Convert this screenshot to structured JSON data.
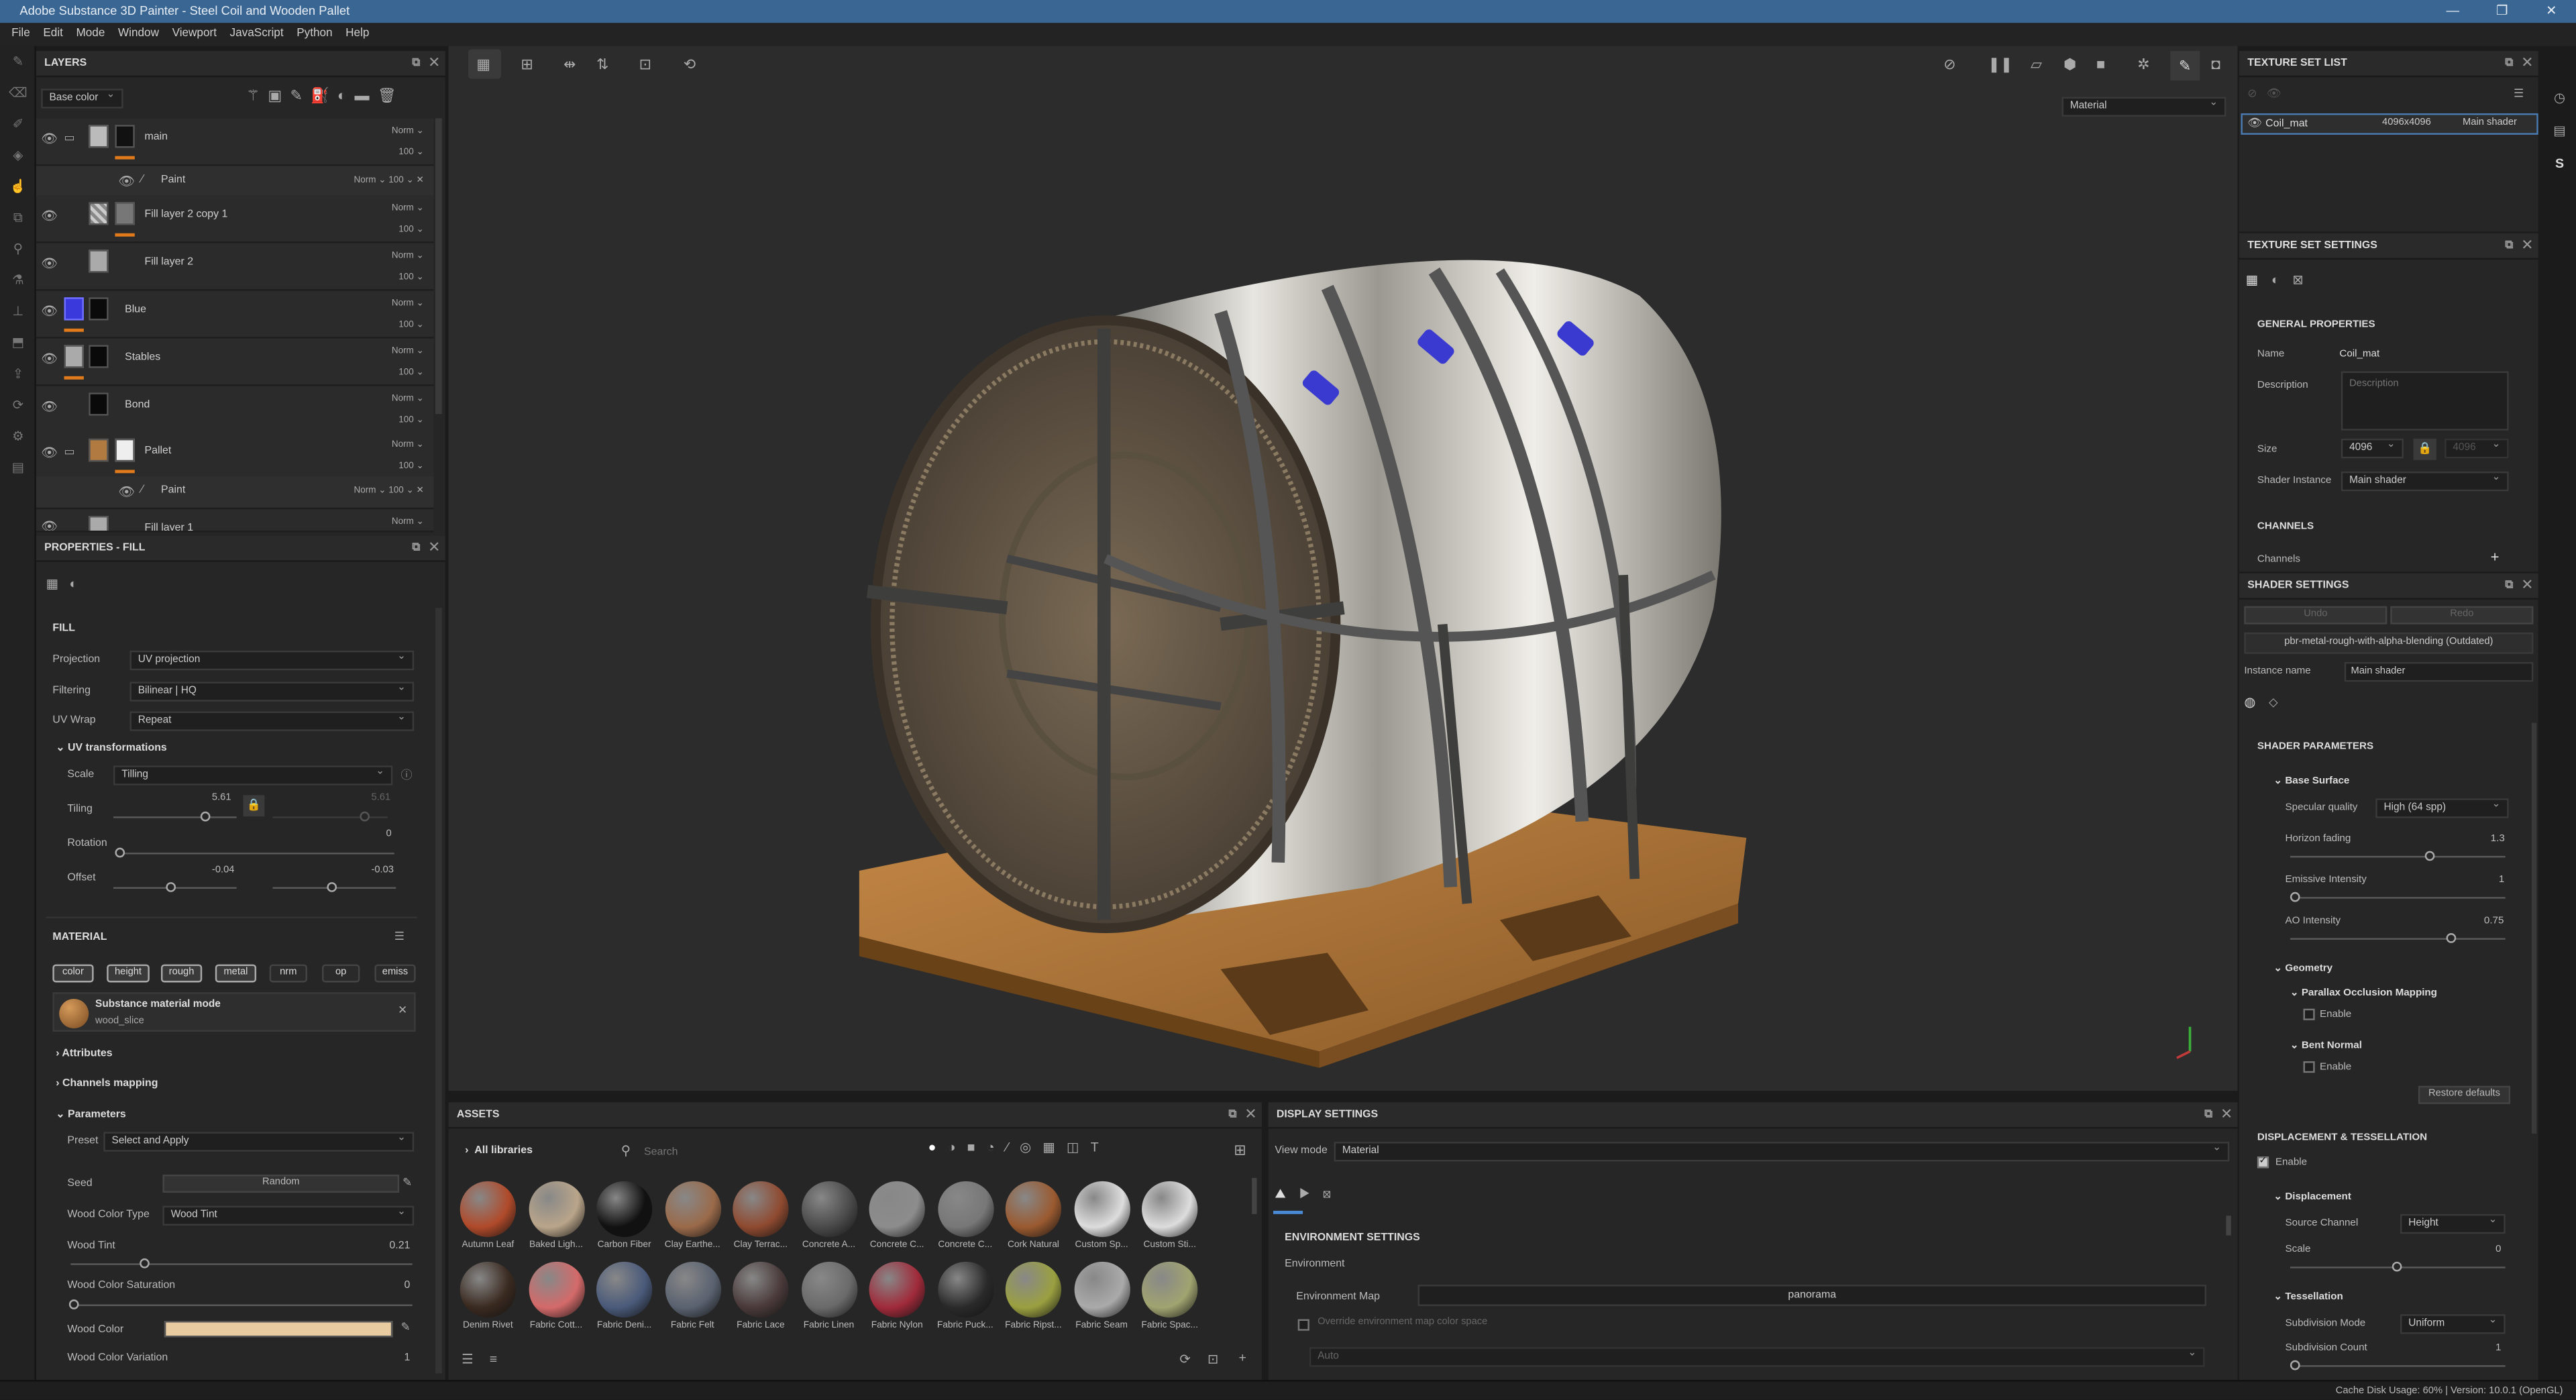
{
  "window": {
    "title": "Adobe Substance 3D Painter - Steel Coil and Wooden Pallet"
  },
  "menu": [
    "File",
    "Edit",
    "Mode",
    "Window",
    "Viewport",
    "JavaScript",
    "Python",
    "Help"
  ],
  "layers": {
    "title": "LAYERS",
    "channel": "Base color",
    "items": [
      {
        "name": "main",
        "blend": "Norm",
        "opacity": "100",
        "type": "folder"
      },
      {
        "name": "Paint",
        "blend": "Norm",
        "opacity": "100",
        "type": "sub"
      },
      {
        "name": "Fill layer 2 copy 1",
        "blend": "Norm",
        "opacity": "100"
      },
      {
        "name": "Fill layer 2",
        "blend": "Norm",
        "opacity": "100"
      },
      {
        "name": "Blue",
        "blend": "Norm",
        "opacity": "100"
      },
      {
        "name": "Stables",
        "blend": "Norm",
        "opacity": "100"
      },
      {
        "name": "Bond",
        "blend": "Norm",
        "opacity": "100"
      },
      {
        "name": "Pallet",
        "blend": "Norm",
        "opacity": "100",
        "type": "folder"
      },
      {
        "name": "Paint",
        "blend": "Norm",
        "opacity": "100",
        "type": "sub"
      },
      {
        "name": "Fill layer 1",
        "blend": "Norm",
        "opacity": ""
      }
    ]
  },
  "properties": {
    "title": "PROPERTIES - FILL",
    "section": "FILL",
    "projection_label": "Projection",
    "projection": "UV projection",
    "filtering_label": "Filtering",
    "filtering": "Bilinear | HQ",
    "uvwrap_label": "UV Wrap",
    "uvwrap": "Repeat",
    "uvtrans": "UV transformations",
    "scale_label": "Scale",
    "scale": "Tilling",
    "tiling_label": "Tiling",
    "tiling": "5.61",
    "tiling2": "5.61",
    "rotation_label": "Rotation",
    "rotation": "0",
    "offset_label": "Offset",
    "offset1": "-0.04",
    "offset2": "-0.03",
    "material": "MATERIAL",
    "chips": [
      "color",
      "height",
      "rough",
      "metal",
      "nrm",
      "op",
      "emiss"
    ],
    "mat_mode": "Substance material mode",
    "mat_name": "wood_slice",
    "attributes": "Attributes",
    "channels_mapping": "Channels mapping",
    "parameters": "Parameters",
    "preset_label": "Preset",
    "preset": "Select and Apply",
    "seed_label": "Seed",
    "seed": "Random",
    "wct_label": "Wood Color Type",
    "wct": "Wood Tint",
    "wtint_label": "Wood Tint",
    "wtint": "0.21",
    "wcs_label": "Wood Color Saturation",
    "wcs": "0",
    "wc_label": "Wood Color",
    "wood_color": "#e8cba0",
    "wcv_label": "Wood Color Variation",
    "wcv": "1"
  },
  "viewport": {
    "mode": "Material"
  },
  "assets": {
    "title": "ASSETS",
    "library": "All libraries",
    "search_placeholder": "Search",
    "row1": [
      {
        "n": "Autumn Leaf",
        "c": "#b04a2a"
      },
      {
        "n": "Baked Ligh...",
        "c": "#b9a58a"
      },
      {
        "n": "Carbon Fiber",
        "c": "#111"
      },
      {
        "n": "Clay Earthe...",
        "c": "#9a6a4a"
      },
      {
        "n": "Clay Terrac...",
        "c": "#8f4a30"
      },
      {
        "n": "Concrete A...",
        "c": "#4a4a4a"
      },
      {
        "n": "Concrete C...",
        "c": "#8c8c8c"
      },
      {
        "n": "Concrete C...",
        "c": "#777"
      },
      {
        "n": "Cork Natural",
        "c": "#9a5a30"
      },
      {
        "n": "Custom Sp...",
        "c": "#ddd"
      },
      {
        "n": "Custom Sti...",
        "c": "#ddd"
      }
    ],
    "row2": [
      {
        "n": "Denim Rivet",
        "c": "#3a2a20"
      },
      {
        "n": "Fabric Cott...",
        "c": "#d46a6a"
      },
      {
        "n": "Fabric Deni...",
        "c": "#4a5a7a"
      },
      {
        "n": "Fabric Felt",
        "c": "#5a6270"
      },
      {
        "n": "Fabric Lace",
        "c": "#4a3a3a"
      },
      {
        "n": "Fabric Linen",
        "c": "#6a6a6a"
      },
      {
        "n": "Fabric Nylon",
        "c": "#a02a3a"
      },
      {
        "n": "Fabric Puck...",
        "c": "#2a2a2a"
      },
      {
        "n": "Fabric Ripst...",
        "c": "#9aa040"
      },
      {
        "n": "Fabric Seam",
        "c": "#aaa"
      },
      {
        "n": "Fabric Spac...",
        "c": "#a0a470"
      }
    ]
  },
  "display": {
    "title": "DISPLAY SETTINGS",
    "viewmode_label": "View mode",
    "viewmode": "Material",
    "env_settings": "ENVIRONMENT SETTINGS",
    "environment": "Environment",
    "envmap_label": "Environment Map",
    "envmap": "panorama",
    "override": "Override environment map color space",
    "auto": "Auto"
  },
  "texset": {
    "title": "TEXTURE SET LIST",
    "name": "Coil_mat",
    "res": "4096x4096",
    "shader": "Main shader"
  },
  "tss": {
    "title": "TEXTURE SET SETTINGS",
    "general": "GENERAL PROPERTIES",
    "name_label": "Name",
    "name": "Coil_mat",
    "desc_label": "Description",
    "desc_placeholder": "Description",
    "size_label": "Size",
    "size": "4096",
    "size2": "4096",
    "shader_label": "Shader Instance",
    "shader": "Main shader",
    "channels": "CHANNELS",
    "channels_sub": "Channels"
  },
  "shader": {
    "title": "SHADER SETTINGS",
    "undo": "Undo",
    "redo": "Redo",
    "shader_name": "pbr-metal-rough-with-alpha-blending (Outdated)",
    "instance_label": "Instance name",
    "instance": "Main shader",
    "params": "SHADER PARAMETERS",
    "base": "Base Surface",
    "spec_label": "Specular quality",
    "spec": "High (64 spp)",
    "horizon_label": "Horizon fading",
    "horizon": "1.3",
    "emissive_label": "Emissive Intensity",
    "emissive": "1",
    "ao_label": "AO Intensity",
    "ao": "0.75",
    "geometry": "Geometry",
    "pom": "Parallax Occlusion Mapping",
    "enable": "Enable",
    "bent": "Bent Normal",
    "enable2": "Enable",
    "restore": "Restore defaults",
    "disp_tess": "DISPLACEMENT & TESSELLATION",
    "enable3": "Enable",
    "displacement": "Displacement",
    "source_label": "Source Channel",
    "source": "Height",
    "scale_label": "Scale",
    "scale": "0",
    "tess": "Tessellation",
    "submode_label": "Subdivision Mode",
    "submode": "Uniform",
    "subcount_label": "Subdivision Count",
    "subcount": "1"
  },
  "status": {
    "text": "Cache Disk Usage:    60% | Version: 10.0.1 (OpenGL)"
  }
}
